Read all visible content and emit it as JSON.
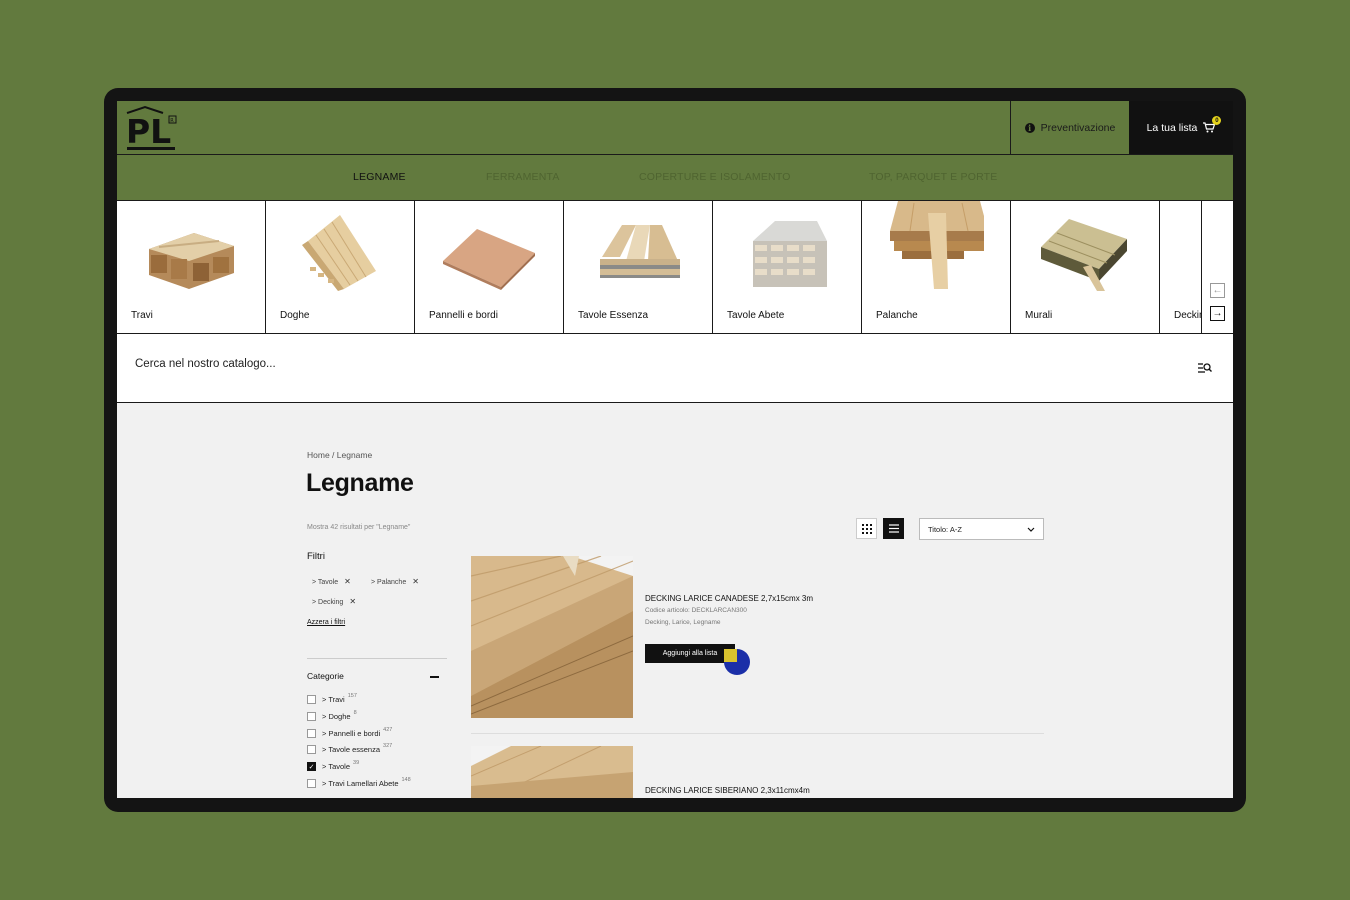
{
  "colors": {
    "accent_green": "#627a3e",
    "dark": "#111111",
    "badge_yellow": "#e4d21c",
    "cursor_blue": "#1b2fa8"
  },
  "header": {
    "logo_text": "PL",
    "quote_label": "Preventivazione",
    "list_label": "La tua lista",
    "list_count": "0"
  },
  "nav": {
    "items": [
      {
        "label": "LEGNAME",
        "active": true
      },
      {
        "label": "FERRAMENTA",
        "active": false
      },
      {
        "label": "COPERTURE E ISOLAMENTO",
        "active": false
      },
      {
        "label": "TOP, PARQUET E PORTE",
        "active": false
      }
    ]
  },
  "categories": [
    {
      "label": "Travi",
      "icon": "beams-image"
    },
    {
      "label": "Doghe",
      "icon": "slats-image"
    },
    {
      "label": "Pannelli e bordi",
      "icon": "panels-image"
    },
    {
      "label": "Tavole Essenza",
      "icon": "essence-boards-image"
    },
    {
      "label": "Tavole Abete",
      "icon": "fir-boards-image"
    },
    {
      "label": "Palanche",
      "icon": "planks-image"
    },
    {
      "label": "Murali",
      "icon": "murali-image"
    },
    {
      "label": "Decking",
      "icon": "decking-image"
    }
  ],
  "search": {
    "placeholder": "Cerca nel nostro catalogo..."
  },
  "page": {
    "breadcrumb": "Home / Legname",
    "title": "Legname",
    "results": "Mostra 42 risultati per \"Legname\""
  },
  "sort": {
    "selected": "Titolo: A-Z"
  },
  "filters": {
    "title": "Filtri",
    "active": [
      "> Tavole",
      "> Palanche",
      "> Decking"
    ],
    "reset_label": "Azzera i filtri",
    "categories_title": "Categorie",
    "categories": [
      {
        "label": "> Travi",
        "count": "157",
        "checked": false
      },
      {
        "label": "> Doghe",
        "count": "8",
        "checked": false
      },
      {
        "label": "> Pannelli e bordi",
        "count": "427",
        "checked": false
      },
      {
        "label": "> Tavole essenza",
        "count": "327",
        "checked": false
      },
      {
        "label": "> Tavole",
        "count": "39",
        "checked": true
      },
      {
        "label": "> Travi Lamellari Abete",
        "count": "148",
        "checked": false
      }
    ]
  },
  "products": [
    {
      "name": "DECKING LARICE CANADESE 2,7x15cmx 3m",
      "code": "Codice articolo: DECKLARCAN300",
      "tags": "Decking, Larice, Legname",
      "button_label": "Aggiungi alla lista"
    },
    {
      "name": "DECKING LARICE SIBERIANO 2,3x11cmx4m"
    }
  ]
}
